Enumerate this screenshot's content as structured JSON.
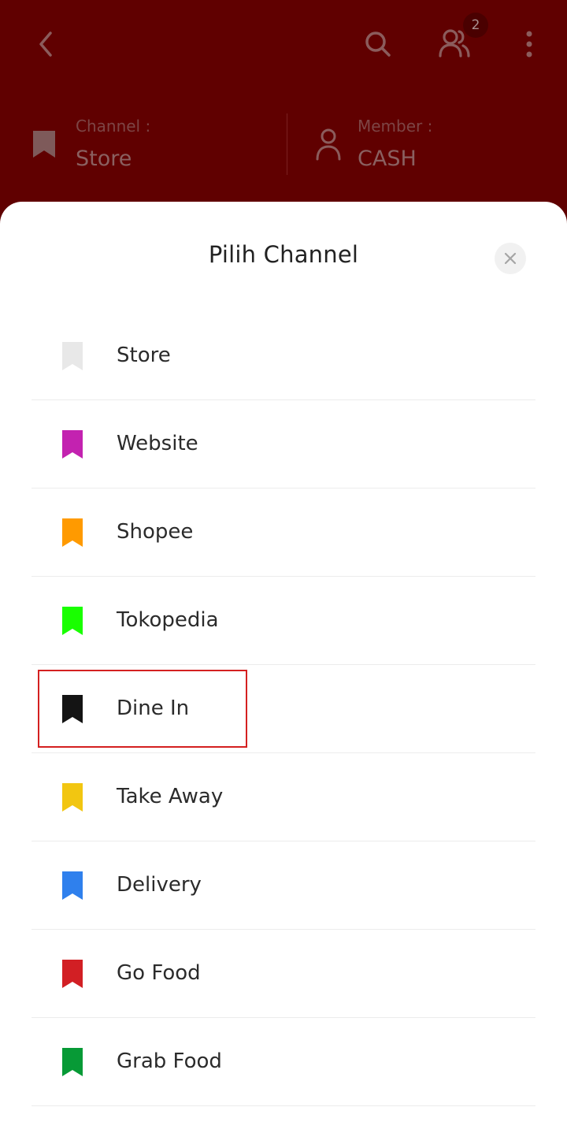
{
  "header": {
    "member_count_badge": "2",
    "channel_label": "Channel :",
    "channel_value": "Store",
    "member_label": "Member :",
    "member_value": "CASH"
  },
  "sheet": {
    "title": "Pilih Channel",
    "channels": [
      {
        "label": "Store",
        "color": "#e8e8e8"
      },
      {
        "label": "Website",
        "color": "#c322b0"
      },
      {
        "label": "Shopee",
        "color": "#ff9a00"
      },
      {
        "label": "Tokopedia",
        "color": "#19ff00"
      },
      {
        "label": "Dine In",
        "color": "#141414"
      },
      {
        "label": "Take Away",
        "color": "#f2c611"
      },
      {
        "label": "Delivery",
        "color": "#2f80ed"
      },
      {
        "label": "Go Food",
        "color": "#d21f24"
      },
      {
        "label": "Grab Food",
        "color": "#079a36"
      }
    ],
    "highlighted_item": "Dine In"
  },
  "colors": {
    "header_bg": "#600000",
    "highlight_border": "#d42020"
  },
  "icons": [
    "back-icon",
    "search-icon",
    "members-icon",
    "more-icon",
    "bookmark-icon",
    "user-icon",
    "close-icon"
  ]
}
